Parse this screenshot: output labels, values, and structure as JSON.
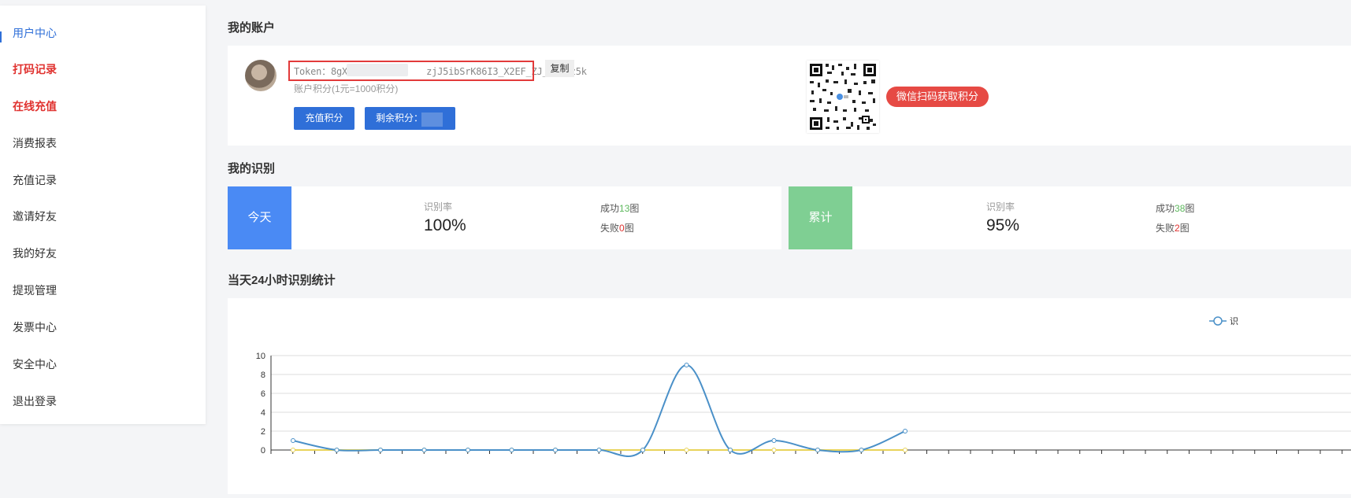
{
  "sidebar": {
    "items": [
      {
        "label": "用户中心"
      },
      {
        "label": "打码记录"
      },
      {
        "label": "在线充值"
      },
      {
        "label": "消费报表"
      },
      {
        "label": "充值记录"
      },
      {
        "label": "邀请好友"
      },
      {
        "label": "我的好友"
      },
      {
        "label": "提现管理"
      },
      {
        "label": "发票中心"
      },
      {
        "label": "安全中心"
      },
      {
        "label": "退出登录"
      }
    ]
  },
  "account": {
    "title": "我的账户",
    "token_label": "Token：",
    "token_value_prefix": "8gX0D",
    "token_value_suffix": "zjJ5ibSrK86I3_X2EF_ZJ_yleoz5k",
    "copy_label": "复制",
    "points_note": "账户积分(1元=1000积分)",
    "recharge_button": "充值积分",
    "remaining_button": "剩余积分：",
    "scan_badge": "微信扫码获取积分"
  },
  "recognition": {
    "title": "我的识别",
    "today": {
      "tag": "今天",
      "rate_label": "识别率",
      "rate_value": "100%",
      "success_prefix": "成功",
      "success_count": "13",
      "success_suffix": "图",
      "fail_prefix": "失败",
      "fail_count": "0",
      "fail_suffix": "图",
      "tag_color": "#4a8af4"
    },
    "total": {
      "tag": "累计",
      "rate_label": "识别率",
      "rate_value": "95%",
      "success_prefix": "成功",
      "success_count": "38",
      "success_suffix": "图",
      "fail_prefix": "失败",
      "fail_count": "2",
      "fail_suffix": "图",
      "tag_color": "#7fcf93"
    }
  },
  "chart_section": {
    "title": "当天24小时识别统计",
    "legend_partial": "识"
  },
  "chart_data": {
    "type": "line",
    "ylim": [
      0,
      10
    ],
    "yticks": [
      "0",
      "2",
      "4",
      "6",
      "8",
      "10"
    ],
    "x": [
      0,
      1,
      2,
      3,
      4,
      5,
      6,
      7,
      8,
      9,
      10,
      11,
      12,
      13,
      14,
      15,
      16,
      17,
      18,
      19,
      20,
      21,
      22,
      23
    ],
    "series": [
      {
        "color": "#4a90c8",
        "values": [
          1,
          0,
          0,
          0,
          0,
          0,
          0,
          0,
          0,
          9,
          0,
          1,
          0,
          0,
          2,
          null,
          null,
          null,
          null,
          null,
          null,
          null,
          null,
          null
        ]
      },
      {
        "color": "#e8d35a",
        "values": [
          0,
          0,
          0,
          0,
          0,
          0,
          0,
          0,
          0,
          0,
          0,
          0,
          0,
          0,
          0,
          null,
          null,
          null,
          null,
          null,
          null,
          null,
          null,
          null
        ]
      }
    ],
    "grid": true
  }
}
